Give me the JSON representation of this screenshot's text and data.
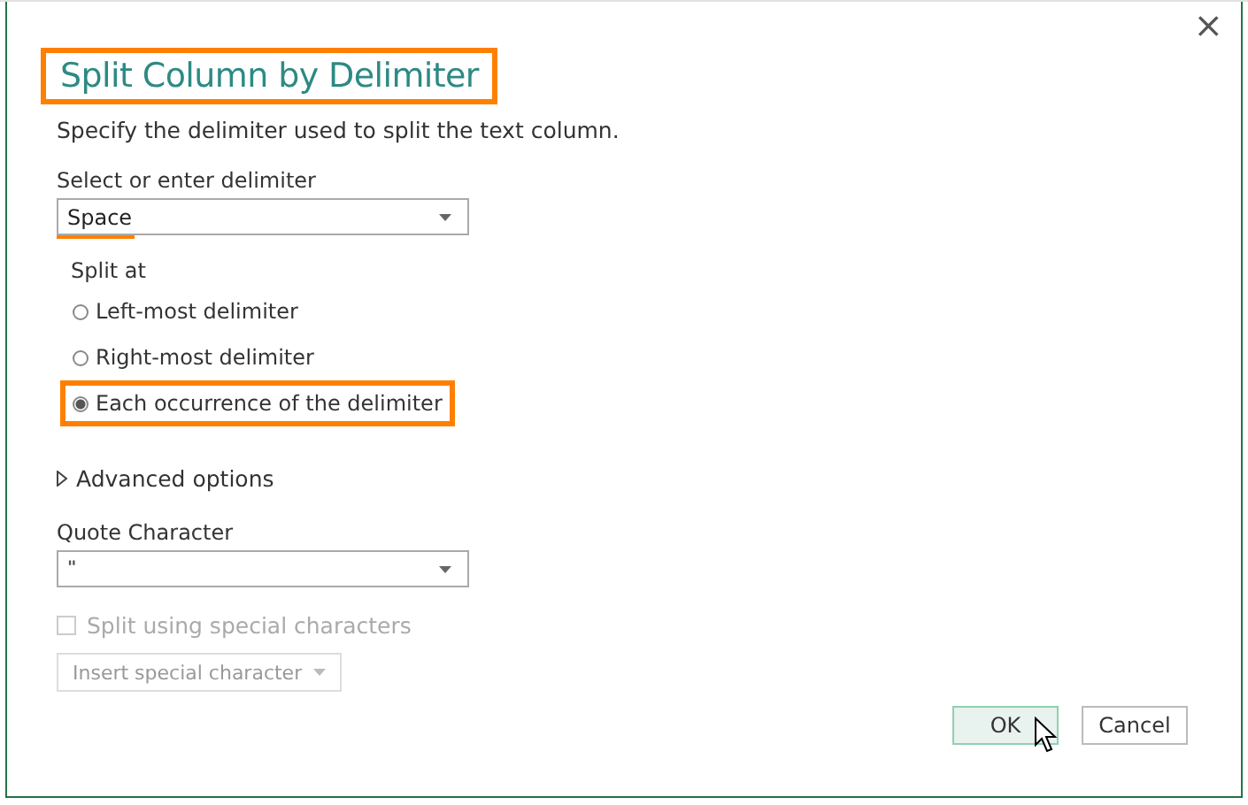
{
  "dialog": {
    "title": "Split Column by Delimiter",
    "title_highlighted": true,
    "description": "Specify the delimiter used to split the text column.",
    "close": "×",
    "delimiter": {
      "label": "Select or enter delimiter",
      "value": "Space",
      "highlighted": true
    },
    "split_at": {
      "label": "Split at",
      "options": [
        {
          "label": "Left-most delimiter",
          "selected": false,
          "highlighted": false
        },
        {
          "label": "Right-most delimiter",
          "selected": false,
          "highlighted": false
        },
        {
          "label": "Each occurrence of the delimiter",
          "selected": true,
          "highlighted": true
        }
      ]
    },
    "advanced": {
      "label": "Advanced options",
      "expanded": false
    },
    "quote": {
      "label": "Quote Character",
      "value": "\""
    },
    "special": {
      "label": "Split using special characters",
      "checked": false,
      "disabled": true
    },
    "insert_button": {
      "label": "Insert special character",
      "disabled": true
    },
    "buttons": [
      {
        "label": "OK",
        "kind": "primary"
      },
      {
        "label": "Cancel",
        "kind": "secondary"
      }
    ]
  }
}
